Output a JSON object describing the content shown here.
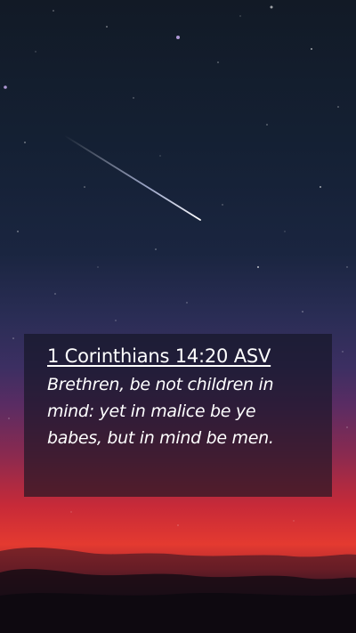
{
  "verse": {
    "reference": "1 Corinthians 14:20 ASV",
    "text": "Brethren, be not children in mind: yet in malice be ye babes, but in mind be men."
  },
  "colors": {
    "sky_top": "#121a26",
    "sky_glow": "#e43a30",
    "text": "#ffffff"
  }
}
